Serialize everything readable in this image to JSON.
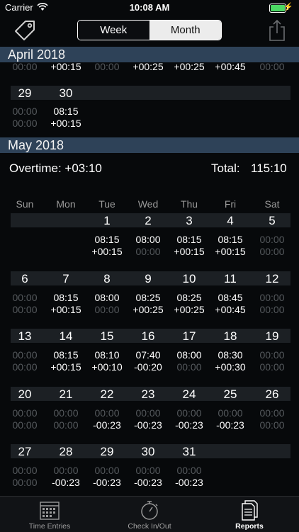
{
  "status_bar": {
    "carrier": "Carrier",
    "time": "10:08 AM"
  },
  "segmented": {
    "week_label": "Week",
    "month_label": "Month",
    "selected": "Month"
  },
  "april": {
    "header": "April 2018",
    "partial_row": [
      [
        "00:00",
        "+00:15",
        "00:00",
        "+00:25",
        "+00:25",
        "+00:45",
        "00:00"
      ]
    ],
    "week": {
      "days": [
        "29",
        "30"
      ],
      "line1": [
        "00:00",
        "08:15"
      ],
      "line2": [
        "00:00",
        "+00:15"
      ]
    }
  },
  "may": {
    "header": "May 2018",
    "overtime": "Overtime: +03:10",
    "total_label": "Total:",
    "total_value": "115:10",
    "weekdays": [
      "Sun",
      "Mon",
      "Tue",
      "Wed",
      "Thu",
      "Fri",
      "Sat"
    ],
    "weeks": [
      {
        "days": [
          "",
          "",
          "1",
          "2",
          "3",
          "4",
          "5"
        ],
        "line1": [
          "",
          "",
          "08:15",
          "08:00",
          "08:15",
          "08:15",
          "00:00"
        ],
        "line2": [
          "",
          "",
          "+00:15",
          "00:00",
          "+00:15",
          "+00:15",
          "00:00"
        ]
      },
      {
        "days": [
          "6",
          "7",
          "8",
          "9",
          "10",
          "11",
          "12"
        ],
        "line1": [
          "00:00",
          "08:15",
          "08:00",
          "08:25",
          "08:25",
          "08:45",
          "00:00"
        ],
        "line2": [
          "00:00",
          "+00:15",
          "00:00",
          "+00:25",
          "+00:25",
          "+00:45",
          "00:00"
        ]
      },
      {
        "days": [
          "13",
          "14",
          "15",
          "16",
          "17",
          "18",
          "19"
        ],
        "line1": [
          "00:00",
          "08:15",
          "08:10",
          "07:40",
          "08:00",
          "08:30",
          "00:00"
        ],
        "line2": [
          "00:00",
          "+00:15",
          "+00:10",
          "-00:20",
          "00:00",
          "+00:30",
          "00:00"
        ]
      },
      {
        "days": [
          "20",
          "21",
          "22",
          "23",
          "24",
          "25",
          "26"
        ],
        "line1": [
          "00:00",
          "00:00",
          "00:00",
          "00:00",
          "00:00",
          "00:00",
          "00:00"
        ],
        "line2": [
          "00:00",
          "00:00",
          "-00:23",
          "-00:23",
          "-00:23",
          "-00:23",
          "00:00"
        ]
      },
      {
        "days": [
          "27",
          "28",
          "29",
          "30",
          "31",
          "",
          ""
        ],
        "line1": [
          "00:00",
          "00:00",
          "00:00",
          "00:00",
          "00:00",
          "",
          ""
        ],
        "line2": [
          "00:00",
          "-00:23",
          "-00:23",
          "-00:23",
          "-00:23",
          "",
          ""
        ]
      }
    ]
  },
  "tabbar": {
    "items": [
      {
        "label": "Time Entries",
        "icon": "calendar-icon",
        "active": false
      },
      {
        "label": "Check In/Out",
        "icon": "stopwatch-icon",
        "active": false
      },
      {
        "label": "Reports",
        "icon": "reports-icon",
        "active": true
      }
    ]
  },
  "colors": {
    "header_bg": "#2e4258",
    "bar_bg": "#1c2024",
    "dim_text": "#55595d",
    "battery": "#4cd964"
  }
}
